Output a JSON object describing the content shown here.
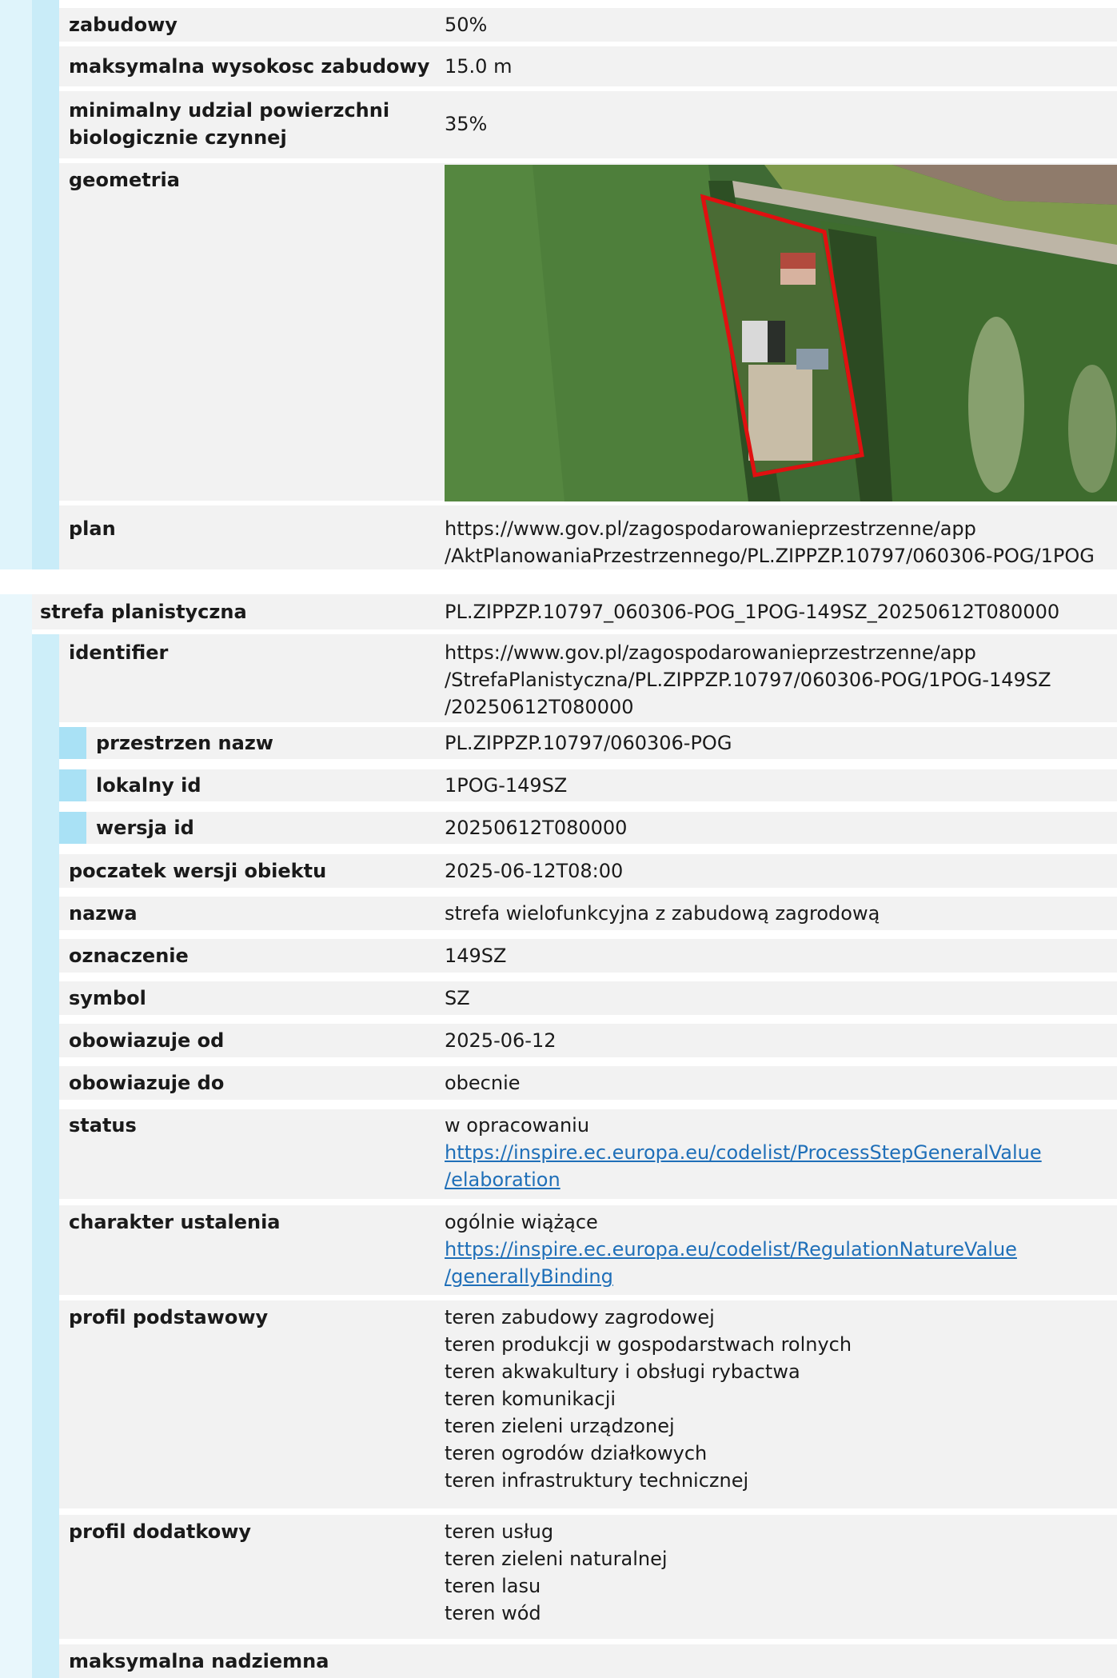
{
  "top": {
    "rows": [
      {
        "label": "zabudowy",
        "value": "50%"
      },
      {
        "label": "maksymalna wysokosc zabudowy",
        "value": "15.0 m"
      },
      {
        "label": "minimalny udzial powierzchni biologicznie czynnej",
        "value": "35%"
      },
      {
        "label": "geometria"
      },
      {
        "label": "plan",
        "value_lines": [
          "https://www.gov.pl/zagospodarowanieprzestrzenne/app",
          "/AktPlanowaniaPrzestrzennego/PL.ZIPPZP.10797/060306-POG/1POG"
        ]
      }
    ]
  },
  "strefa": {
    "label": "strefa planistyczna",
    "value": "PL.ZIPPZP.10797_060306-POG_1POG-149SZ_20250612T080000",
    "identifier": {
      "label": "identifier",
      "value_lines": [
        "https://www.gov.pl/zagospodarowanieprzestrzenne/app",
        "/StrefaPlanistyczna/PL.ZIPPZP.10797/060306-POG/1POG-149SZ",
        "/20250612T080000"
      ],
      "przestrzen": {
        "label": "przestrzen nazw",
        "value": "PL.ZIPPZP.10797/060306-POG"
      },
      "lokalny": {
        "label": "lokalny id",
        "value": "1POG-149SZ"
      },
      "wersja": {
        "label": "wersja id",
        "value": "20250612T080000"
      }
    },
    "poczatek": {
      "label": "poczatek wersji obiektu",
      "value": "2025-06-12T08:00"
    },
    "nazwa": {
      "label": "nazwa",
      "value": "strefa wielofunkcyjna z zabudową zagrodową"
    },
    "oznaczenie": {
      "label": "oznaczenie",
      "value": "149SZ"
    },
    "symbol": {
      "label": "symbol",
      "value": "SZ"
    },
    "od": {
      "label": "obowiazuje od",
      "value": "2025-06-12"
    },
    "do": {
      "label": "obowiazuje do",
      "value": "obecnie"
    },
    "status": {
      "label": "status",
      "text": "w opracowaniu",
      "link_lines": [
        "https://inspire.ec.europa.eu/codelist/ProcessStepGeneralValue",
        "/elaboration"
      ]
    },
    "charakter": {
      "label": "charakter ustalenia",
      "text": "ogólnie wiążące",
      "link_lines": [
        "https://inspire.ec.europa.eu/codelist/RegulationNatureValue",
        "/generallyBinding"
      ]
    },
    "profil_podst": {
      "label": "profil podstawowy",
      "items": [
        "teren zabudowy zagrodowej",
        "teren produkcji w gospodarstwach rolnych",
        "teren akwakultury i obsługi rybactwa",
        "teren komunikacji",
        "teren zieleni urządzonej",
        "teren ogrodów działkowych",
        "teren infrastruktury technicznej"
      ]
    },
    "profil_dod": {
      "label": "profil dodatkowy",
      "items": [
        "teren usług",
        "teren zieleni naturalnej",
        "teren lasu",
        "teren wód"
      ]
    },
    "max_nadz": {
      "label": "maksymalna nadziemna"
    }
  },
  "colors": {
    "link": "#1f6fb8",
    "boundary": "#e01010"
  }
}
